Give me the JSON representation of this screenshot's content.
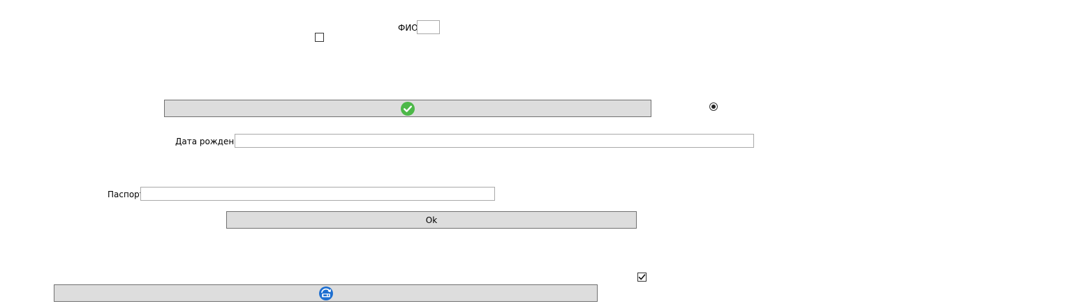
{
  "form": {
    "fio": {
      "label": "ФИО",
      "value": ""
    },
    "agree_checkbox": {
      "checked": false
    },
    "confirm_button": {
      "icon": "check-circle-icon",
      "icon_color": "#4cb848"
    },
    "option_radio": {
      "selected": true
    },
    "birth_date": {
      "label": "Дата рождения",
      "value": ""
    },
    "passport": {
      "label": "Паспорт",
      "value": ""
    },
    "ok_button": {
      "label": "Ok"
    },
    "done_checkbox": {
      "checked": true
    },
    "save_button": {
      "icon": "disk-refresh-icon",
      "icon_color": "#1e6fd0"
    }
  }
}
